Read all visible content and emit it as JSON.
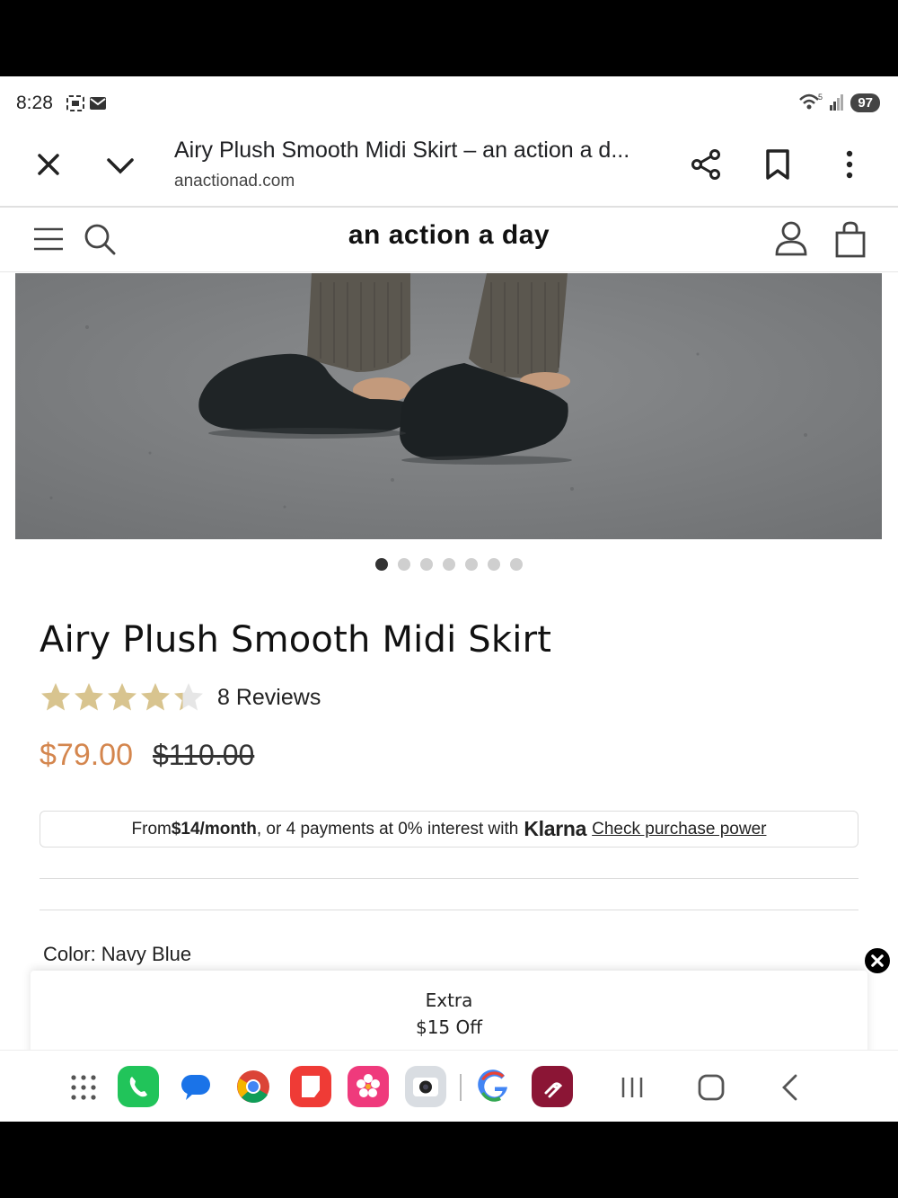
{
  "status_bar": {
    "time": "8:28",
    "battery": "97",
    "network": "5"
  },
  "browser": {
    "page_title": "Airy Plush Smooth Midi Skirt – an action a d...",
    "url": "anactionad.com"
  },
  "site": {
    "logo": "an action a day"
  },
  "carousel": {
    "total_dots": 7,
    "active_index": 0
  },
  "product": {
    "title": "Airy Plush Smooth Midi Skirt",
    "rating_stars": 4.3,
    "reviews_label": "8 Reviews",
    "sale_price": "$79.00",
    "original_price": "$110.00",
    "klarna": {
      "prefix": "From ",
      "monthly": "$14/month",
      "middle": ", or 4 payments at 0% interest with ",
      "brand": "Klarna",
      "link": "Check purchase power"
    },
    "color_label": "Color: Navy Blue"
  },
  "promo": {
    "line1": "Extra",
    "line2": "$15 Off"
  },
  "colors": {
    "sale_price": "#d4864e",
    "star": "#d8c48f"
  }
}
